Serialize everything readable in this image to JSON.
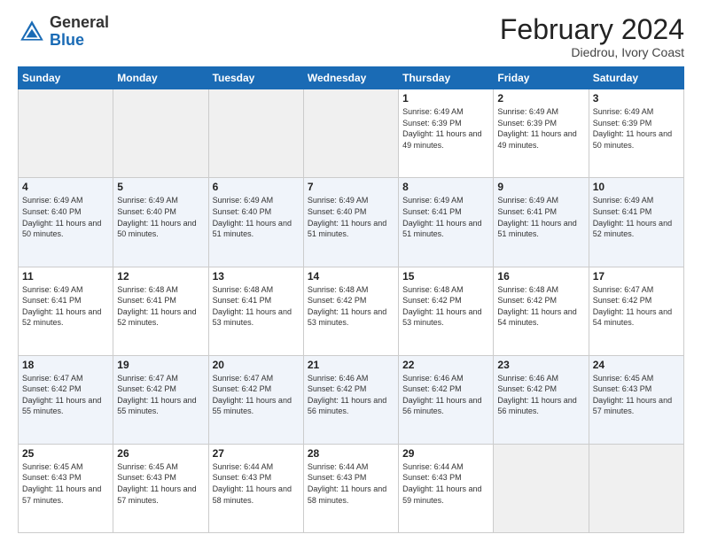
{
  "header": {
    "logo_general": "General",
    "logo_blue": "Blue",
    "title": "February 2024",
    "location": "Diedrou, Ivory Coast"
  },
  "days_of_week": [
    "Sunday",
    "Monday",
    "Tuesday",
    "Wednesday",
    "Thursday",
    "Friday",
    "Saturday"
  ],
  "weeks": [
    [
      {
        "day": "",
        "info": ""
      },
      {
        "day": "",
        "info": ""
      },
      {
        "day": "",
        "info": ""
      },
      {
        "day": "",
        "info": ""
      },
      {
        "day": "1",
        "info": "Sunrise: 6:49 AM\nSunset: 6:39 PM\nDaylight: 11 hours and 49 minutes."
      },
      {
        "day": "2",
        "info": "Sunrise: 6:49 AM\nSunset: 6:39 PM\nDaylight: 11 hours and 49 minutes."
      },
      {
        "day": "3",
        "info": "Sunrise: 6:49 AM\nSunset: 6:39 PM\nDaylight: 11 hours and 50 minutes."
      }
    ],
    [
      {
        "day": "4",
        "info": "Sunrise: 6:49 AM\nSunset: 6:40 PM\nDaylight: 11 hours and 50 minutes."
      },
      {
        "day": "5",
        "info": "Sunrise: 6:49 AM\nSunset: 6:40 PM\nDaylight: 11 hours and 50 minutes."
      },
      {
        "day": "6",
        "info": "Sunrise: 6:49 AM\nSunset: 6:40 PM\nDaylight: 11 hours and 51 minutes."
      },
      {
        "day": "7",
        "info": "Sunrise: 6:49 AM\nSunset: 6:40 PM\nDaylight: 11 hours and 51 minutes."
      },
      {
        "day": "8",
        "info": "Sunrise: 6:49 AM\nSunset: 6:41 PM\nDaylight: 11 hours and 51 minutes."
      },
      {
        "day": "9",
        "info": "Sunrise: 6:49 AM\nSunset: 6:41 PM\nDaylight: 11 hours and 51 minutes."
      },
      {
        "day": "10",
        "info": "Sunrise: 6:49 AM\nSunset: 6:41 PM\nDaylight: 11 hours and 52 minutes."
      }
    ],
    [
      {
        "day": "11",
        "info": "Sunrise: 6:49 AM\nSunset: 6:41 PM\nDaylight: 11 hours and 52 minutes."
      },
      {
        "day": "12",
        "info": "Sunrise: 6:48 AM\nSunset: 6:41 PM\nDaylight: 11 hours and 52 minutes."
      },
      {
        "day": "13",
        "info": "Sunrise: 6:48 AM\nSunset: 6:41 PM\nDaylight: 11 hours and 53 minutes."
      },
      {
        "day": "14",
        "info": "Sunrise: 6:48 AM\nSunset: 6:42 PM\nDaylight: 11 hours and 53 minutes."
      },
      {
        "day": "15",
        "info": "Sunrise: 6:48 AM\nSunset: 6:42 PM\nDaylight: 11 hours and 53 minutes."
      },
      {
        "day": "16",
        "info": "Sunrise: 6:48 AM\nSunset: 6:42 PM\nDaylight: 11 hours and 54 minutes."
      },
      {
        "day": "17",
        "info": "Sunrise: 6:47 AM\nSunset: 6:42 PM\nDaylight: 11 hours and 54 minutes."
      }
    ],
    [
      {
        "day": "18",
        "info": "Sunrise: 6:47 AM\nSunset: 6:42 PM\nDaylight: 11 hours and 55 minutes."
      },
      {
        "day": "19",
        "info": "Sunrise: 6:47 AM\nSunset: 6:42 PM\nDaylight: 11 hours and 55 minutes."
      },
      {
        "day": "20",
        "info": "Sunrise: 6:47 AM\nSunset: 6:42 PM\nDaylight: 11 hours and 55 minutes."
      },
      {
        "day": "21",
        "info": "Sunrise: 6:46 AM\nSunset: 6:42 PM\nDaylight: 11 hours and 56 minutes."
      },
      {
        "day": "22",
        "info": "Sunrise: 6:46 AM\nSunset: 6:42 PM\nDaylight: 11 hours and 56 minutes."
      },
      {
        "day": "23",
        "info": "Sunrise: 6:46 AM\nSunset: 6:42 PM\nDaylight: 11 hours and 56 minutes."
      },
      {
        "day": "24",
        "info": "Sunrise: 6:45 AM\nSunset: 6:43 PM\nDaylight: 11 hours and 57 minutes."
      }
    ],
    [
      {
        "day": "25",
        "info": "Sunrise: 6:45 AM\nSunset: 6:43 PM\nDaylight: 11 hours and 57 minutes."
      },
      {
        "day": "26",
        "info": "Sunrise: 6:45 AM\nSunset: 6:43 PM\nDaylight: 11 hours and 57 minutes."
      },
      {
        "day": "27",
        "info": "Sunrise: 6:44 AM\nSunset: 6:43 PM\nDaylight: 11 hours and 58 minutes."
      },
      {
        "day": "28",
        "info": "Sunrise: 6:44 AM\nSunset: 6:43 PM\nDaylight: 11 hours and 58 minutes."
      },
      {
        "day": "29",
        "info": "Sunrise: 6:44 AM\nSunset: 6:43 PM\nDaylight: 11 hours and 59 minutes."
      },
      {
        "day": "",
        "info": ""
      },
      {
        "day": "",
        "info": ""
      }
    ]
  ]
}
